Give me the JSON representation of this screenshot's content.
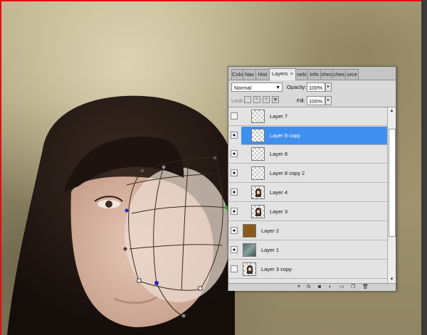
{
  "panel": {
    "tabs": [
      {
        "label": "Colo"
      },
      {
        "label": "Nav"
      },
      {
        "label": "Hist"
      },
      {
        "label": "Layers",
        "close": "×"
      },
      {
        "label": "nels"
      },
      {
        "label": "Info"
      },
      {
        "label": "ches"
      },
      {
        "label": "ches"
      },
      {
        "label": "urce"
      }
    ],
    "blend_mode": "Normal",
    "opacity_label": "Opacity:",
    "opacity_value": "100%",
    "lock_label": "Lock:",
    "fill_label": "Fill:",
    "fill_value": "100%",
    "layers": [
      {
        "name": "Layer 7",
        "visible": false,
        "thumb": "transparent"
      },
      {
        "name": "Layer 8 copy",
        "visible": true,
        "selected": true,
        "thumb": "transparent"
      },
      {
        "name": "Layer 8",
        "visible": true,
        "thumb": "transparent"
      },
      {
        "name": "Layer 8 copy 2",
        "visible": true,
        "thumb": "transparent"
      },
      {
        "name": "Layer 4",
        "visible": true,
        "thumb": "portrait"
      },
      {
        "name": "Layer 3",
        "visible": true,
        "thumb": "portrait"
      },
      {
        "name": "Layer 2",
        "visible": true,
        "thumb": "gold"
      },
      {
        "name": "Layer 1",
        "visible": true,
        "thumb": "teal"
      },
      {
        "name": "Layer 3 copy",
        "visible": false,
        "thumb": "portrait"
      }
    ]
  },
  "colors": {
    "selection": "#3f8fef",
    "canvas_border": "#dd1111",
    "warp_mesh": "#3a2a1a"
  }
}
